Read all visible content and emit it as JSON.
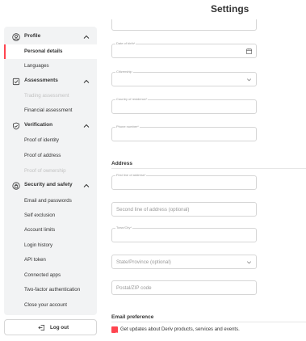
{
  "page": {
    "title": "Settings"
  },
  "sidebar": {
    "groups": [
      {
        "label": "Profile",
        "icon": "user-icon",
        "items": [
          {
            "label": "Personal details",
            "state": "active"
          },
          {
            "label": "Languages",
            "state": "normal"
          }
        ]
      },
      {
        "label": "Assessments",
        "icon": "clipboard-icon",
        "items": [
          {
            "label": "Trading assessment",
            "state": "disabled"
          },
          {
            "label": "Financial assessment",
            "state": "normal"
          }
        ]
      },
      {
        "label": "Verification",
        "icon": "shield-check-icon",
        "items": [
          {
            "label": "Proof of identity",
            "state": "normal"
          },
          {
            "label": "Proof of address",
            "state": "normal"
          },
          {
            "label": "Proof of ownership",
            "state": "disabled"
          }
        ]
      },
      {
        "label": "Security and safety",
        "icon": "lock-icon",
        "items": [
          {
            "label": "Email and passwords",
            "state": "normal"
          },
          {
            "label": "Self exclusion",
            "state": "normal"
          },
          {
            "label": "Account limits",
            "state": "normal"
          },
          {
            "label": "Login history",
            "state": "normal"
          },
          {
            "label": "API token",
            "state": "normal"
          },
          {
            "label": "Connected apps",
            "state": "normal"
          },
          {
            "label": "Two-factor authentication",
            "state": "normal"
          },
          {
            "label": "Close your account",
            "state": "normal"
          }
        ]
      }
    ],
    "logout_label": "Log out"
  },
  "form": {
    "date_of_birth_label": "Date of birth*",
    "citizenship_label": "Citizenship",
    "country_label": "Country of residence*",
    "phone_label": "Phone number*",
    "address_section": "Address",
    "address1_label": "First line of address*",
    "address2_placeholder": "Second line of address (optional)",
    "city_label": "Town/City*",
    "state_placeholder": "State/Province (optional)",
    "postcode_placeholder": "Postal/ZIP code"
  },
  "email_preference": {
    "title": "Email preference",
    "checkbox_label": "Get updates about Deriv products, services and events.",
    "checked": true
  },
  "colors": {
    "accent": "#ff444f",
    "sidebar_bg": "#f2f3f4",
    "border": "#d6d6d6"
  }
}
